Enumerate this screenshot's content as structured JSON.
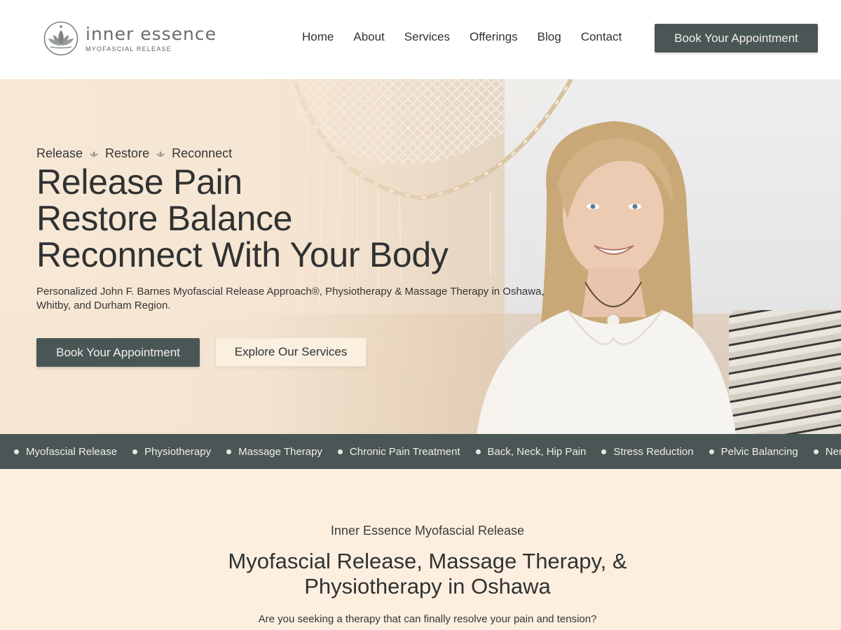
{
  "brand": {
    "name": "inner essence",
    "tagline": "MYOFASCIAL RELEASE",
    "logo_icon": "lotus-circle-icon"
  },
  "nav": {
    "items": [
      {
        "label": "Home"
      },
      {
        "label": "About"
      },
      {
        "label": "Services"
      },
      {
        "label": "Offerings"
      },
      {
        "label": "Blog"
      },
      {
        "label": "Contact"
      }
    ],
    "cta_label": "Book Your Appointment"
  },
  "hero": {
    "kicker": [
      "Release",
      "Restore",
      "Reconnect"
    ],
    "title_lines": [
      "Release Pain",
      "Restore Balance",
      "Reconnect With Your Body"
    ],
    "subtitle": "Personalized John F. Barnes Myofascial Release Approach®, Physiotherapy & Massage Therapy in Oshawa, Whitby, and Durham Region.",
    "primary_cta": "Book Your Appointment",
    "secondary_cta": "Explore Our Services"
  },
  "ticker": {
    "items": [
      "Myofascial Release",
      "Physiotherapy",
      "Massage Therapy",
      "Chronic Pain Treatment",
      "Back, Neck, Hip Pain",
      "Stress Reduction",
      "Pelvic Balancing",
      "Nervous"
    ]
  },
  "intro": {
    "eyebrow": "Inner Essence Myofascial Release",
    "title_lines": [
      "Myofascial Release, Massage Therapy, &",
      "Physiotherapy in Oshawa"
    ],
    "question": "Are you seeking a therapy that can finally resolve your pain and tension?"
  },
  "colors": {
    "accent_dark": "#4a5656",
    "cream_background": "#fcefdf",
    "light_button": "#fbefe0"
  }
}
